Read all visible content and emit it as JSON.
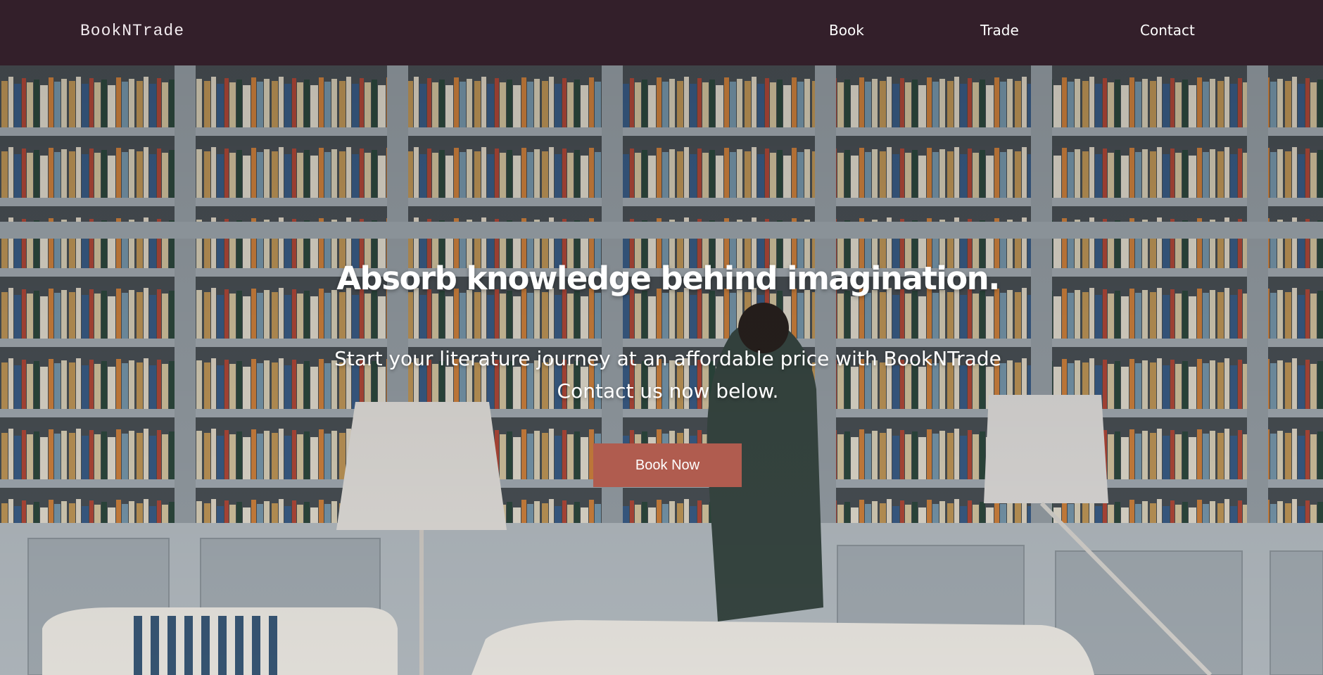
{
  "navbar": {
    "brand": "BookNTrade",
    "links": [
      {
        "label": "Book"
      },
      {
        "label": "Trade"
      },
      {
        "label": "Contact"
      }
    ]
  },
  "hero": {
    "title": "Absorb knowledge behind imagination.",
    "subtitle_line1": "Start your literature journey at an affordable price with BookNTrade",
    "subtitle_line2": "Contact us now below.",
    "cta_label": "Book Now",
    "background": "bookshelf-room-photo"
  },
  "colors": {
    "navbar_bg": "#331f2a",
    "cta_bg": "#b05c4f",
    "text": "#ffffff"
  }
}
